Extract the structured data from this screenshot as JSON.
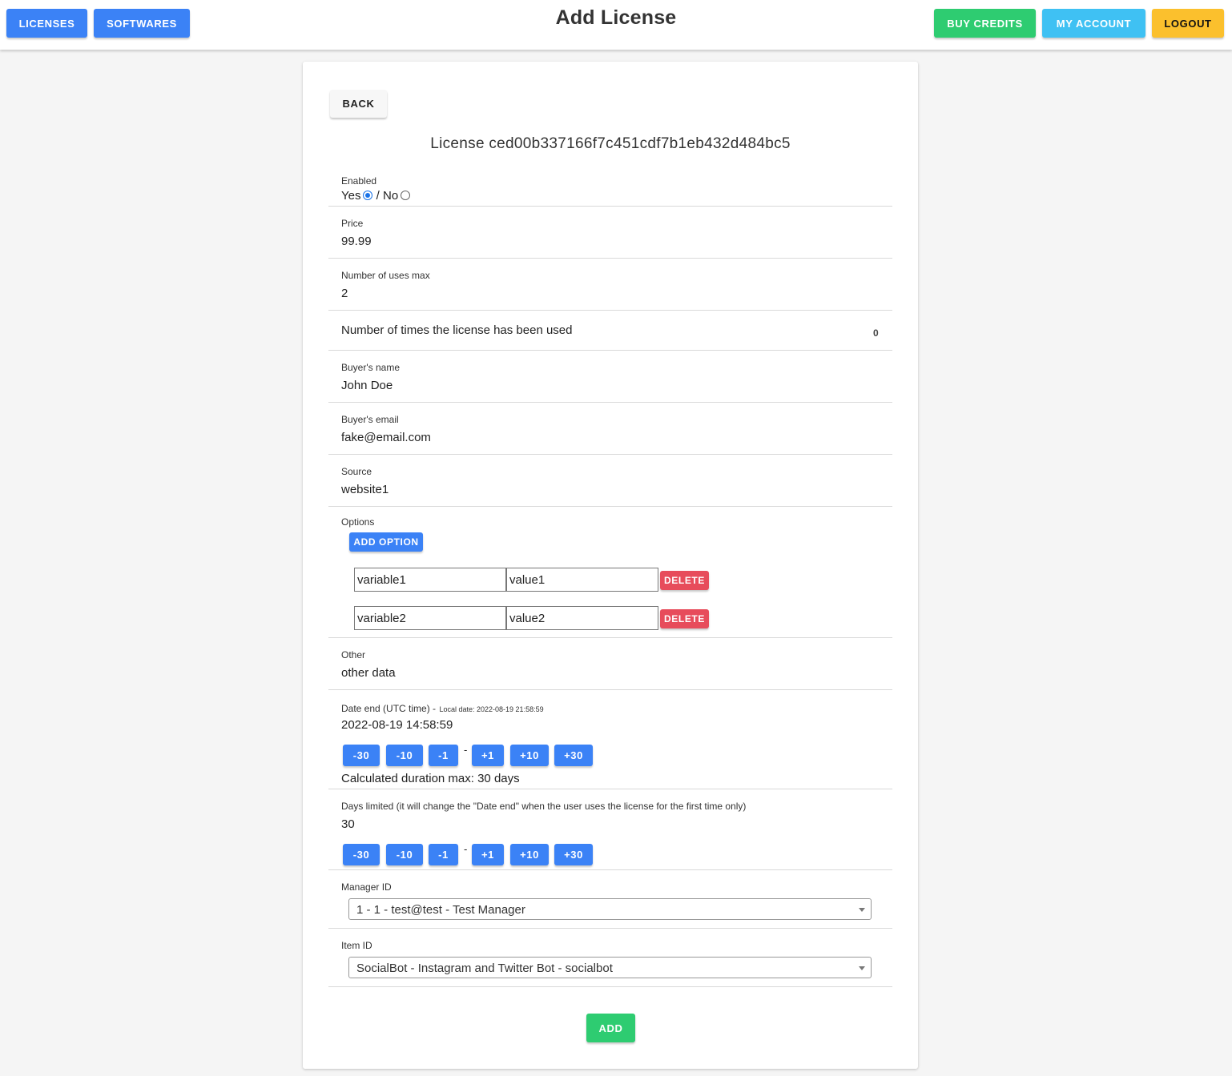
{
  "header": {
    "title": "Add License",
    "nav_left": [
      "LICENSES",
      "SOFTWARES"
    ],
    "buy_credits": "BUY CREDITS",
    "my_account": "MY ACCOUNT",
    "logout": "LOGOUT"
  },
  "card": {
    "back_label": "BACK",
    "license_title": "License ced00b337166f7c451cdf7b1eb432d484bc5",
    "enabled": {
      "label": "Enabled",
      "yes": "Yes",
      "separator": "/",
      "no": "No",
      "selected": "Yes"
    },
    "price": {
      "label": "Price",
      "value": "99.99"
    },
    "max_uses": {
      "label": "Number of uses max",
      "value": "2"
    },
    "times_used": {
      "label": "Number of times the license has been used",
      "value": "0"
    },
    "buyer_name": {
      "label": "Buyer's name",
      "value": "John Doe"
    },
    "buyer_email": {
      "label": "Buyer's email",
      "value": "fake@email.com"
    },
    "source": {
      "label": "Source",
      "value": "website1"
    },
    "options": {
      "label": "Options",
      "add_label": "ADD OPTION",
      "delete_label": "DELETE",
      "rows": [
        {
          "key": "variable1",
          "value": "value1"
        },
        {
          "key": "variable2",
          "value": "value2"
        }
      ]
    },
    "other": {
      "label": "Other",
      "value": "other data"
    },
    "date_end": {
      "label": "Date end (UTC time) -",
      "local_date": "Local date: 2022-08-19 21:58:59",
      "value": "2022-08-19 14:58:59",
      "duration": "Calculated duration max: 30 days"
    },
    "days_limited": {
      "label": "Days limited (it will change the \"Date end\" when the user uses the license for the first time only)",
      "value": "30"
    },
    "steps": [
      "-30",
      "-10",
      "-1",
      "-",
      "+1",
      "+10",
      "+30"
    ],
    "manager": {
      "label": "Manager ID",
      "selected": "1 - 1 - test@test - Test Manager"
    },
    "item": {
      "label": "Item ID",
      "selected": "SocialBot - Instagram and Twitter Bot - socialbot"
    },
    "add_label": "ADD"
  },
  "colors": {
    "primary": "#3b82f6",
    "success": "#2ecc71",
    "info": "#3fc1f3",
    "warning": "#fbc02d",
    "danger": "#e74c5b"
  }
}
